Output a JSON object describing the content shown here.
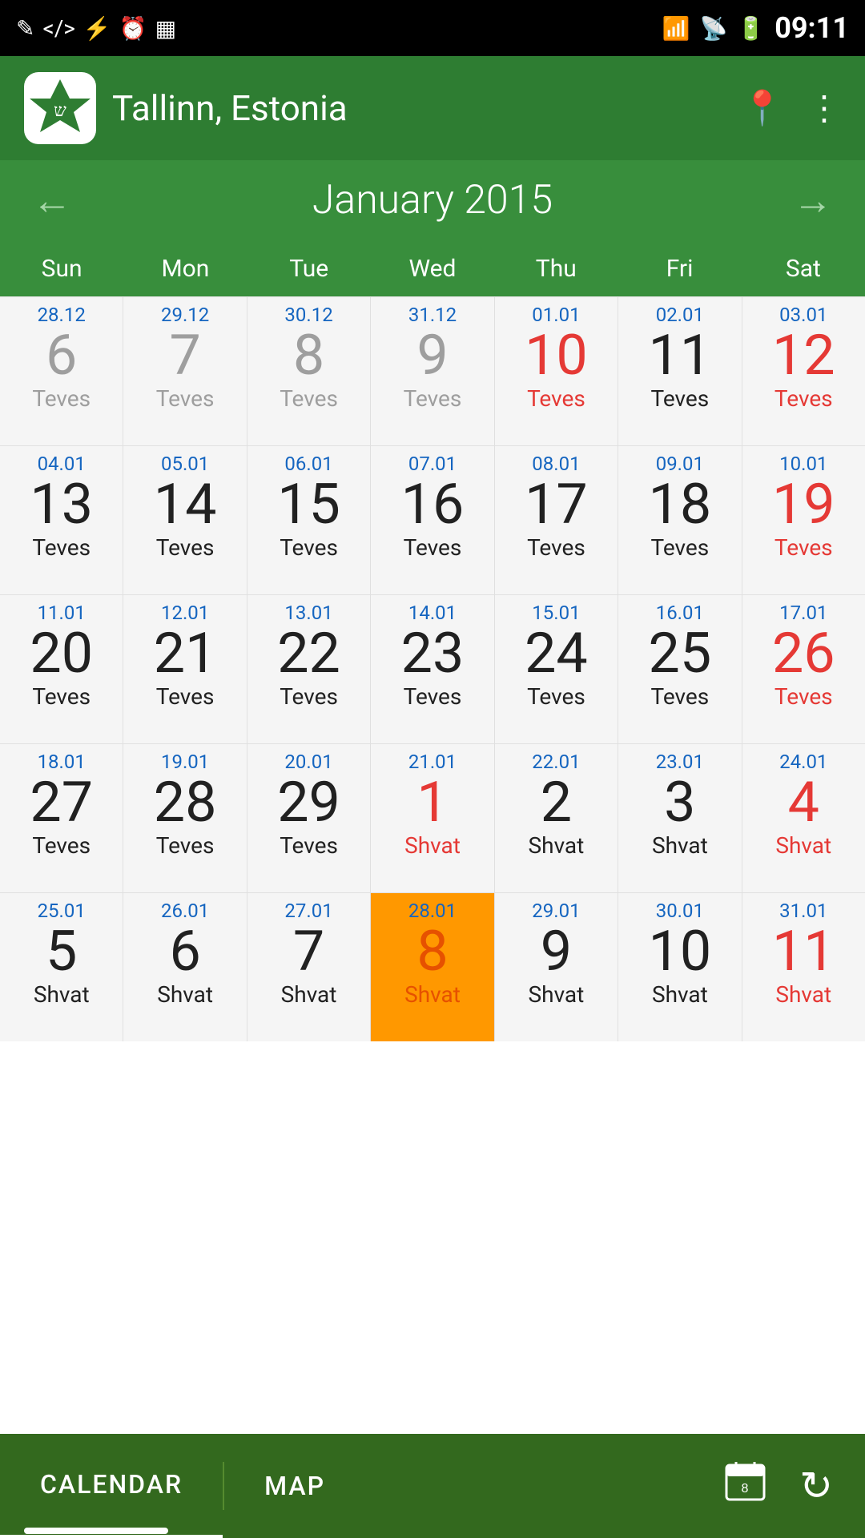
{
  "statusBar": {
    "time": "09:11",
    "icons": [
      "✎",
      "</>",
      "⚡",
      "⏰",
      "▦"
    ]
  },
  "header": {
    "location": "Tallinn, Estonia",
    "locationIcon": "📍",
    "moreIcon": "⋮"
  },
  "monthNav": {
    "title": "January 2015",
    "prevArrow": "←",
    "nextArrow": "→"
  },
  "dayHeaders": [
    "Sun",
    "Mon",
    "Tue",
    "Wed",
    "Thu",
    "Fri",
    "Sat"
  ],
  "weeks": [
    [
      {
        "greg": "28.12",
        "day": "6",
        "heb": "Teves",
        "type": "gray"
      },
      {
        "greg": "29.12",
        "day": "7",
        "heb": "Teves",
        "type": "gray"
      },
      {
        "greg": "30.12",
        "day": "8",
        "heb": "Teves",
        "type": "gray"
      },
      {
        "greg": "31.12",
        "day": "9",
        "heb": "Teves",
        "type": "gray"
      },
      {
        "greg": "01.01",
        "day": "10",
        "heb": "Teves",
        "type": "red"
      },
      {
        "greg": "02.01",
        "day": "11",
        "heb": "Teves",
        "type": "normal"
      },
      {
        "greg": "03.01",
        "day": "12",
        "heb": "Teves",
        "type": "sat-red"
      }
    ],
    [
      {
        "greg": "04.01",
        "day": "13",
        "heb": "Teves",
        "type": "normal"
      },
      {
        "greg": "05.01",
        "day": "14",
        "heb": "Teves",
        "type": "normal"
      },
      {
        "greg": "06.01",
        "day": "15",
        "heb": "Teves",
        "type": "normal"
      },
      {
        "greg": "07.01",
        "day": "16",
        "heb": "Teves",
        "type": "normal"
      },
      {
        "greg": "08.01",
        "day": "17",
        "heb": "Teves",
        "type": "normal"
      },
      {
        "greg": "09.01",
        "day": "18",
        "heb": "Teves",
        "type": "normal"
      },
      {
        "greg": "10.01",
        "day": "19",
        "heb": "Teves",
        "type": "sat-red"
      }
    ],
    [
      {
        "greg": "11.01",
        "day": "20",
        "heb": "Teves",
        "type": "normal"
      },
      {
        "greg": "12.01",
        "day": "21",
        "heb": "Teves",
        "type": "normal"
      },
      {
        "greg": "13.01",
        "day": "22",
        "heb": "Teves",
        "type": "normal"
      },
      {
        "greg": "14.01",
        "day": "23",
        "heb": "Teves",
        "type": "normal"
      },
      {
        "greg": "15.01",
        "day": "24",
        "heb": "Teves",
        "type": "normal"
      },
      {
        "greg": "16.01",
        "day": "25",
        "heb": "Teves",
        "type": "normal"
      },
      {
        "greg": "17.01",
        "day": "26",
        "heb": "Teves",
        "type": "sat-red"
      }
    ],
    [
      {
        "greg": "18.01",
        "day": "27",
        "heb": "Teves",
        "type": "normal"
      },
      {
        "greg": "19.01",
        "day": "28",
        "heb": "Teves",
        "type": "normal"
      },
      {
        "greg": "20.01",
        "day": "29",
        "heb": "Teves",
        "type": "normal"
      },
      {
        "greg": "21.01",
        "day": "1",
        "heb": "Shvat",
        "type": "red"
      },
      {
        "greg": "22.01",
        "day": "2",
        "heb": "Shvat",
        "type": "normal"
      },
      {
        "greg": "23.01",
        "day": "3",
        "heb": "Shvat",
        "type": "normal"
      },
      {
        "greg": "24.01",
        "day": "4",
        "heb": "Shvat",
        "type": "sat-red"
      }
    ],
    [
      {
        "greg": "25.01",
        "day": "5",
        "heb": "Shvat",
        "type": "normal"
      },
      {
        "greg": "26.01",
        "day": "6",
        "heb": "Shvat",
        "type": "normal"
      },
      {
        "greg": "27.01",
        "day": "7",
        "heb": "Shvat",
        "type": "normal"
      },
      {
        "greg": "28.01",
        "day": "8",
        "heb": "Shvat",
        "type": "today"
      },
      {
        "greg": "29.01",
        "day": "9",
        "heb": "Shvat",
        "type": "normal"
      },
      {
        "greg": "30.01",
        "day": "10",
        "heb": "Shvat",
        "type": "normal"
      },
      {
        "greg": "31.01",
        "day": "11",
        "heb": "Shvat",
        "type": "sat-red"
      }
    ]
  ],
  "bottomNav": {
    "calendarLabel": "CALENDAR",
    "mapLabel": "MAP",
    "calendarIcon": "📅",
    "refreshIcon": "↻"
  }
}
